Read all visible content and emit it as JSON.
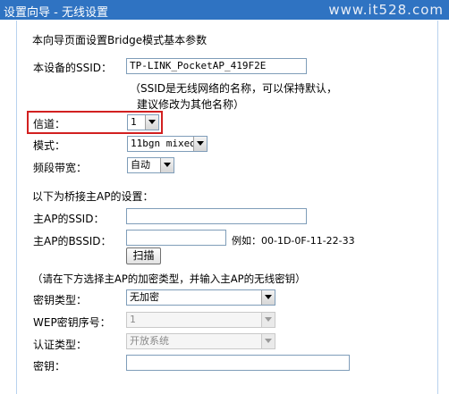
{
  "header": {
    "title": "设置向导 - 无线设置",
    "watermark": "www.it528.com"
  },
  "intro": "本向导页面设置Bridge模式基本参数",
  "ssid": {
    "label": "本设备的SSID：",
    "value": "TP-LINK_PocketAP_419F2E",
    "note_line1": "（SSID是无线网络的名称，可以保持默认，",
    "note_line2": "建议修改为其他名称）"
  },
  "channel": {
    "label": "信道：",
    "value": "1"
  },
  "mode": {
    "label": "模式：",
    "value": "11bgn mixed"
  },
  "bandwidth": {
    "label": "频段带宽：",
    "value": "自动"
  },
  "bridge": {
    "heading": "以下为桥接主AP的设置：",
    "ssid_label": "主AP的SSID：",
    "ssid_value": "",
    "bssid_label": "主AP的BSSID：",
    "bssid_value": "",
    "bssid_example": "例如：00-1D-0F-11-22-33",
    "scan_button": "扫描"
  },
  "security_note": "（请在下方选择主AP的加密类型，并输入主AP的无线密钥）",
  "key_type": {
    "label": "密钥类型：",
    "value": "无加密"
  },
  "wep_index": {
    "label": "WEP密钥序号：",
    "value": "1"
  },
  "auth_type": {
    "label": "认证类型：",
    "value": "开放系统"
  },
  "key": {
    "label": "密钥：",
    "value": ""
  },
  "colors": {
    "titlebar": "#2f73c2",
    "highlight": "#d22020",
    "panel_border": "#b9d2ee"
  }
}
